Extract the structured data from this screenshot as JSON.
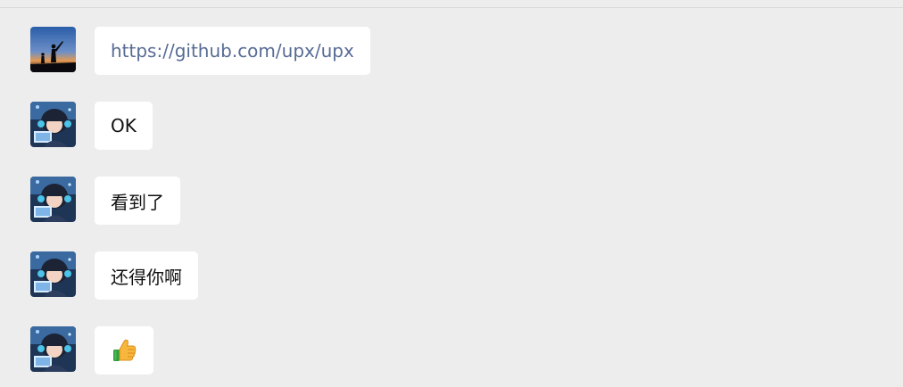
{
  "colors": {
    "background": "#ededed",
    "bubble": "#ffffff",
    "link": "#576b95",
    "text": "#111111"
  },
  "messages": [
    {
      "sender": "user-sunset",
      "type": "link",
      "text": "https://github.com/upx/upx"
    },
    {
      "sender": "user-anime",
      "type": "text",
      "text": "OK"
    },
    {
      "sender": "user-anime",
      "type": "text",
      "text": "看到了"
    },
    {
      "sender": "user-anime",
      "type": "text",
      "text": "还得你啊"
    },
    {
      "sender": "user-anime",
      "type": "emoji",
      "icon": "thumbs-up-icon"
    }
  ]
}
